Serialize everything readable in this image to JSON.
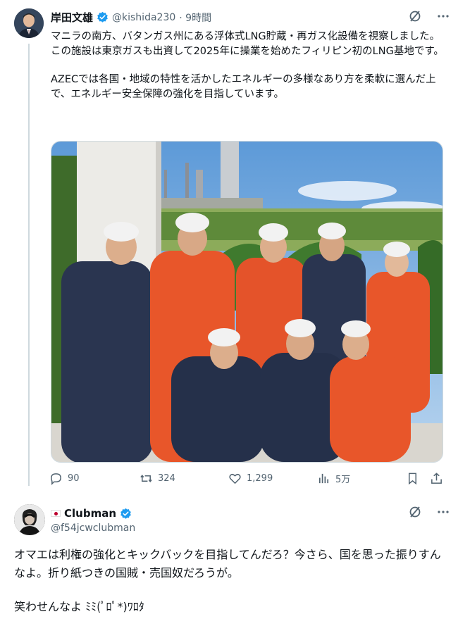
{
  "post": {
    "display_name": "岸田文雄",
    "handle": "@kishida230",
    "time": "· 9時間",
    "text_lines": [
      "マニラの南方、バタンガス州にある浮体式LNG貯蔵・再ガス化設備を視察しました。",
      "この施設は東京ガスも出資して2025年に操業を始めたフィリピン初のLNG基地です。",
      "AZECでは各国・地域の特性を活かしたエネルギーの多様なあり方を柔軟に選んだ上で、エネルギー安全保障の強化を目指しています。"
    ],
    "stats": {
      "replies": "90",
      "reposts": "324",
      "likes": "1,299",
      "views": "5万"
    },
    "icons": [
      "grok-icon",
      "more-icon",
      "reply-icon",
      "repost-icon",
      "like-icon",
      "views-icon",
      "bookmark-icon",
      "share-icon",
      "verified-badge-icon"
    ]
  },
  "reply": {
    "display_name": "Clubman",
    "handle": "@f54jcwclubman",
    "text": "オマエは利権の強化とキックバックを目指してんだろ？今さら、国を思った振りすんなよ。折り紙つきの国賊・売国奴だろうが。",
    "text_last": "笑わせんなよ ﾐﾐ(ﾟﾛﾟ*)ﾜﾛﾀ"
  },
  "colors": {
    "text": "#0f1419",
    "muted": "#536471",
    "verified": "#1d9bf0",
    "border": "#cfd9de",
    "coverall_orange": "#e8562a",
    "coverall_navy": "#2a3550"
  }
}
